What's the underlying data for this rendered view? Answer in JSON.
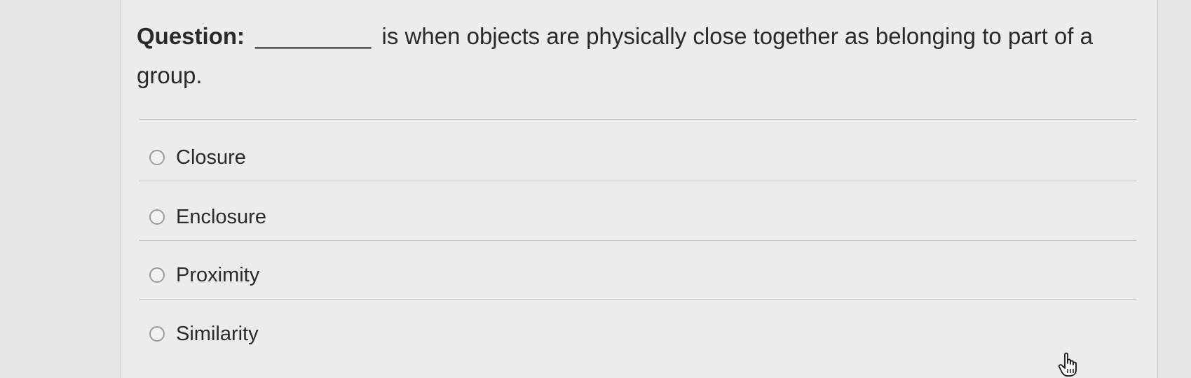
{
  "question": {
    "prefix": "Question:",
    "blank": "_________",
    "text": "is when objects are physically close together as belonging to part of a group."
  },
  "options": [
    {
      "label": "Closure",
      "selected": false
    },
    {
      "label": "Enclosure",
      "selected": false
    },
    {
      "label": "Proximity",
      "selected": false
    },
    {
      "label": "Similarity",
      "selected": false
    }
  ],
  "cursor": {
    "icon": "hand-pointer-icon"
  }
}
